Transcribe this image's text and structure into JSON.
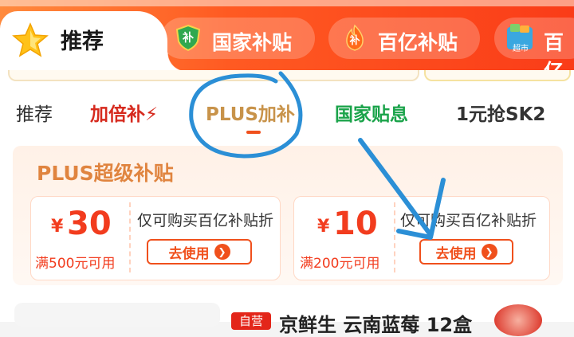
{
  "top_tabs": {
    "active": {
      "label": "推荐",
      "icon": "star-icon"
    },
    "items": [
      {
        "label": "国家补贴",
        "icon": "shield-icon",
        "icon_text": "补"
      },
      {
        "label": "百亿补贴",
        "icon": "flame-icon",
        "icon_text": "补"
      },
      {
        "label": "百亿",
        "icon": "supermarket-icon",
        "icon_text": "超市"
      }
    ]
  },
  "sub_tabs": [
    {
      "label": "推荐",
      "color": "#333333"
    },
    {
      "label": "加倍补⚡",
      "color": "#d62a1e"
    },
    {
      "label": "PLUS加补",
      "color": "#c8934a",
      "active": true
    },
    {
      "label": "国家贴息",
      "color": "#1aa34a"
    },
    {
      "label": "1元抢SK2",
      "color": "#333333"
    }
  ],
  "plus_section": {
    "title": "PLUS超级补贴",
    "coupons": [
      {
        "currency": "¥",
        "amount": "30",
        "condition": "满500元可用",
        "description": "仅可购买百亿补贴折",
        "button": "去使用"
      },
      {
        "currency": "¥",
        "amount": "10",
        "condition": "满200元可用",
        "description": "仅可购买百亿补贴折",
        "button": "去使用"
      }
    ]
  },
  "product": {
    "badge": "自营",
    "title": "京鲜生 云南蓝莓 12盒"
  },
  "colors": {
    "accent": "#f23c1e",
    "header": "#fa4a1e",
    "annotation": "#2b8fd6"
  }
}
